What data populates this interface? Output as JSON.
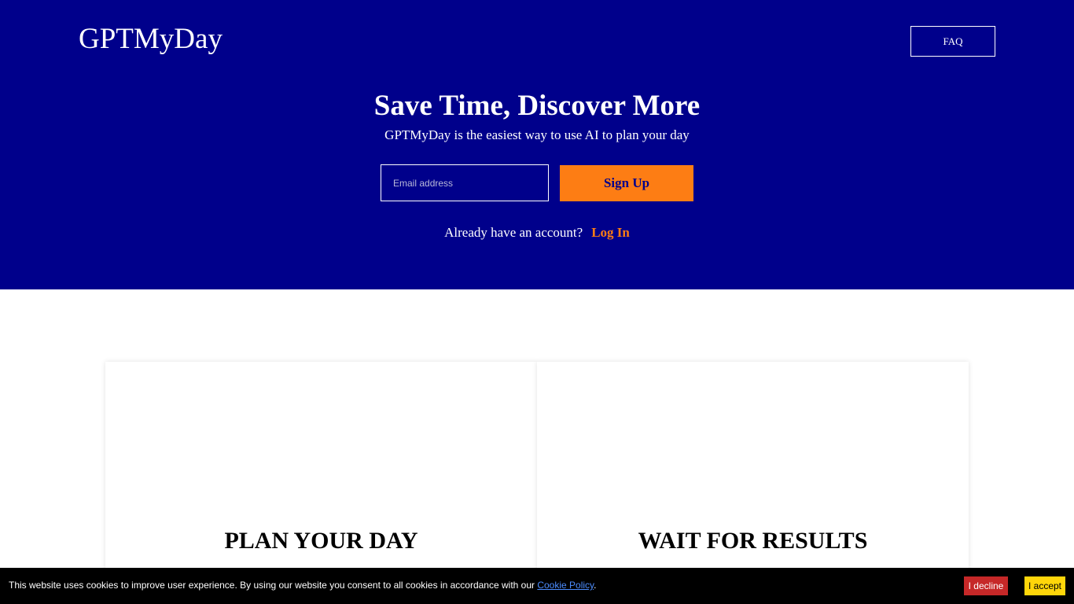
{
  "header": {
    "logo_text": "GPTMyDay",
    "faq_label": "FAQ"
  },
  "hero": {
    "title": "Save Time, Discover More",
    "subtitle": "GPTMyDay is the easiest way to use AI to plan your day",
    "email_placeholder": "Email address",
    "email_value": "",
    "signup_label": "Sign Up",
    "account_prompt": "Already have an account?",
    "login_label": "Log In"
  },
  "features": {
    "items": [
      {
        "title": "PLAN YOUR DAY"
      },
      {
        "title": "WAIT FOR RESULTS"
      }
    ]
  },
  "cookie_banner": {
    "message": "This website uses cookies to improve user experience. By using our website you consent to all cookies in accordance with our ",
    "link_label": "Cookie Policy",
    "message_end": ".",
    "decline_label": "I decline",
    "accept_label": "I accept"
  },
  "colors": {
    "hero_background": "#00008b",
    "accent_orange": "#fd7d14",
    "decline_red": "#c62828",
    "accept_yellow": "#ffd60a",
    "cookie_bar": "#000000"
  }
}
